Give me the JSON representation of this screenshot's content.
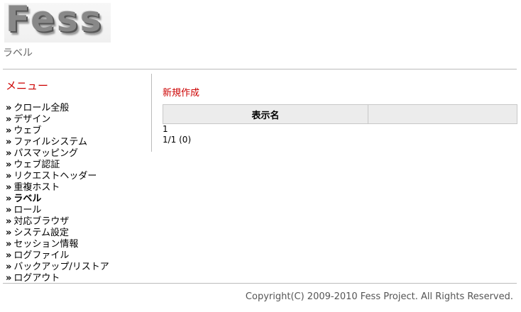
{
  "header": {
    "logo_text": "Fess",
    "page_subtitle": "ラベル"
  },
  "sidebar": {
    "title": "メニュー",
    "bullet": "»",
    "items": [
      {
        "label": "クロール全般",
        "active": false
      },
      {
        "label": "デザイン",
        "active": false
      },
      {
        "label": "ウェブ",
        "active": false
      },
      {
        "label": "ファイルシステム",
        "active": false
      },
      {
        "label": "パスマッピング",
        "active": false
      },
      {
        "label": "ウェブ認証",
        "active": false
      },
      {
        "label": "リクエストヘッダー",
        "active": false
      },
      {
        "label": "重複ホスト",
        "active": false
      },
      {
        "label": "ラベル",
        "active": true
      },
      {
        "label": "ロール",
        "active": false
      },
      {
        "label": "対応ブラウザ",
        "active": false
      },
      {
        "label": "システム設定",
        "active": false
      },
      {
        "label": "セッション情報",
        "active": false
      },
      {
        "label": "ログファイル",
        "active": false
      },
      {
        "label": "バックアップ/リストア",
        "active": false
      },
      {
        "label": "ログアウト",
        "active": false
      }
    ]
  },
  "main": {
    "create_link": "新規作成",
    "table": {
      "columns": [
        "表示名",
        ""
      ]
    },
    "pager": {
      "page_links": "1",
      "summary": "1/1 (0)"
    }
  },
  "footer": {
    "copyright": "Copyright(C) 2009-2010 Fess Project. All Rights Reserved."
  },
  "colors": {
    "accent": "#cc0000",
    "table_header_bg": "#ececec",
    "rule": "#bbbbbb"
  }
}
